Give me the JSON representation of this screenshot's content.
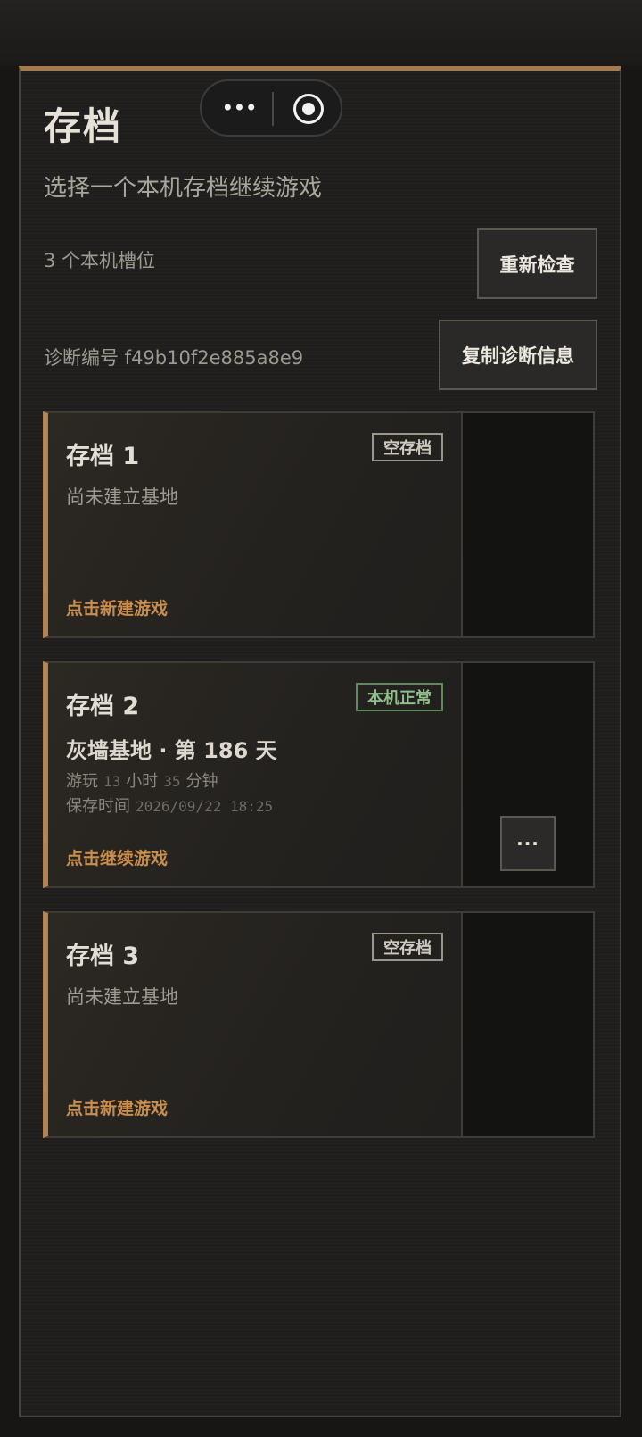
{
  "header": {
    "title": "存档",
    "subtitle": "选择一个本机存档继续游戏"
  },
  "capsule": {
    "more_icon": "•••",
    "close_icon": "target-circle-icon"
  },
  "info": {
    "slot_count": "3 个本机槽位",
    "recheck_label": "重新检查",
    "diagnostic": "诊断编号 f49b10f2e885a8e9",
    "copy_diagnostic_label": "复制诊断信息"
  },
  "slots": [
    {
      "name": "存档 1",
      "badge": "空存档",
      "desc": "尚未建立基地",
      "action": "点击新建游戏"
    },
    {
      "name": "存档 2",
      "badge": "本机正常",
      "base": "灰墙基地 · 第 186 天",
      "play_label": "游玩",
      "play_hours": "13",
      "hours_unit": "小时",
      "play_minutes": "35",
      "minutes_unit": "分钟",
      "saved_label": "保存时间",
      "saved_time": "2026/09/22 18:25",
      "action": "点击继续游戏",
      "more_label": "···"
    },
    {
      "name": "存档 3",
      "badge": "空存档",
      "desc": "尚未建立基地",
      "action": "点击新建游戏"
    }
  ],
  "colors": {
    "accent": "#b08454",
    "action": "#c98d4e",
    "ok": "#8fbf8a"
  }
}
